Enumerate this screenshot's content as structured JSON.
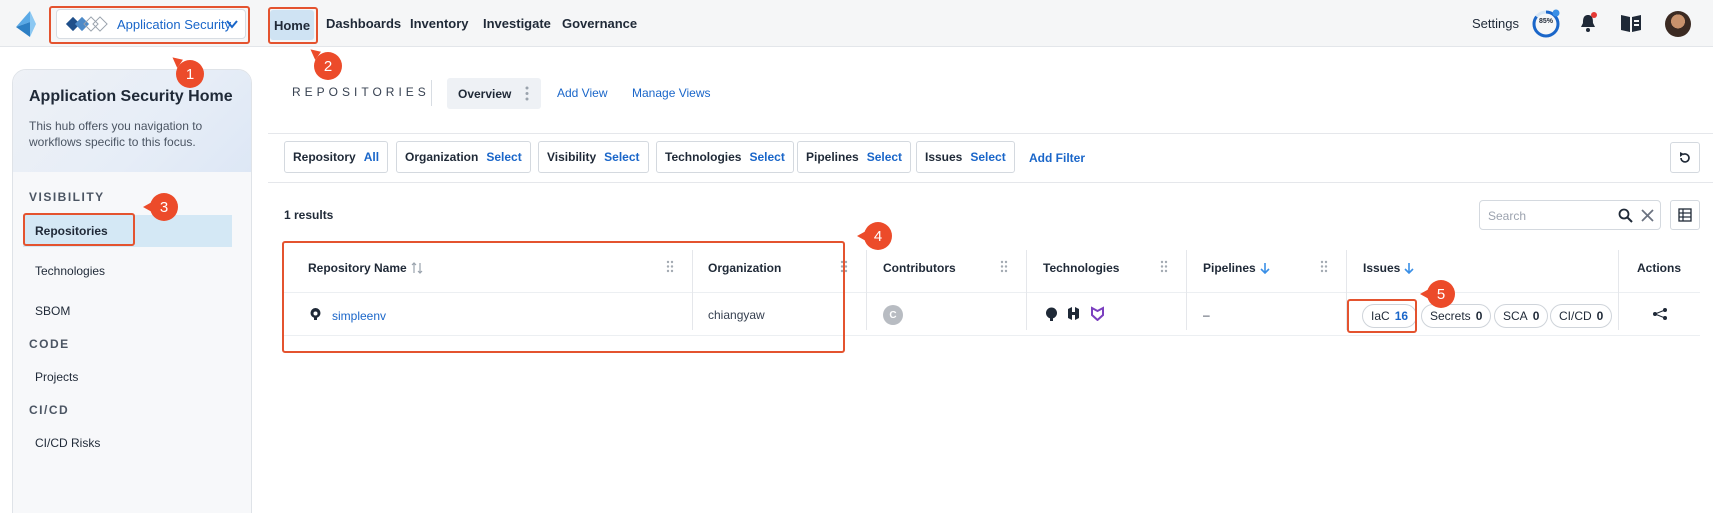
{
  "topnav": {
    "hub_label": "Application Security",
    "items": [
      "Home",
      "Dashboards",
      "Inventory",
      "Investigate",
      "Governance"
    ],
    "settings": "Settings",
    "progress_text": "85%",
    "progress_value": 0.85,
    "accent": "#1a66c9",
    "callout_color": "#ec4b2a"
  },
  "sidebar": {
    "title": "Application Security Home",
    "description": "This hub offers you navigation to workflows specific to this focus.",
    "sections": [
      {
        "label": "VISIBILITY",
        "items": [
          "Repositories",
          "Technologies",
          "SBOM"
        ]
      },
      {
        "label": "CODE",
        "items": [
          "Projects"
        ]
      },
      {
        "label": "CI/CD",
        "items": [
          "CI/CD Risks"
        ]
      }
    ],
    "active_item": "Repositories"
  },
  "main": {
    "heading": "REPOSITORIES",
    "tabs": [
      "Overview"
    ],
    "add_view": "Add View",
    "manage_views": "Manage Views",
    "filters": [
      {
        "key": "Repository",
        "value": "All"
      },
      {
        "key": "Organization",
        "value": "Select"
      },
      {
        "key": "Visibility",
        "value": "Select"
      },
      {
        "key": "Technologies",
        "value": "Select"
      },
      {
        "key": "Pipelines",
        "value": "Select"
      },
      {
        "key": "Issues",
        "value": "Select"
      }
    ],
    "add_filter": "Add Filter",
    "results": "1 results",
    "search_placeholder": "Search"
  },
  "table": {
    "columns": [
      "Repository Name",
      "Organization",
      "Contributors",
      "Technologies",
      "Pipelines",
      "Issues",
      "Actions"
    ],
    "rows": [
      {
        "repository": "simpleenv",
        "organization": "chiangyaw",
        "contributor_initial": "C",
        "technologies": [
          "github-icon",
          "hashicorp-icon",
          "snyk-icon"
        ],
        "pipelines": "–",
        "issues": [
          {
            "label": "IaC",
            "count": "16"
          },
          {
            "label": "Secrets",
            "count": "0"
          },
          {
            "label": "SCA",
            "count": "0"
          },
          {
            "label": "CI/CD",
            "count": "0"
          }
        ]
      }
    ]
  },
  "callouts": [
    "1",
    "2",
    "3",
    "4",
    "5"
  ]
}
